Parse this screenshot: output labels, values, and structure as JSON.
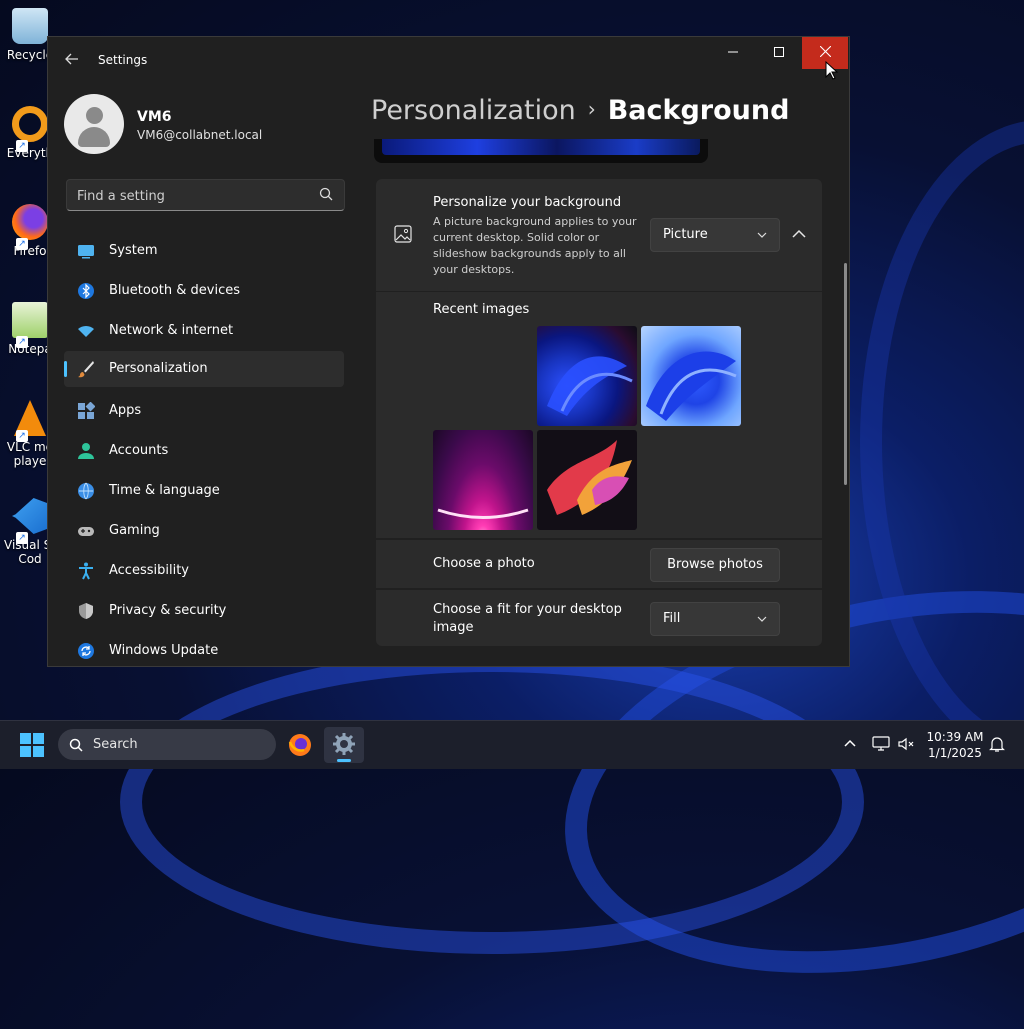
{
  "window": {
    "app_title": "Settings",
    "caption": {
      "minimize": "—",
      "maximize": "☐",
      "close": "✕"
    }
  },
  "user": {
    "name": "VM6",
    "email": "VM6@collabnet.local"
  },
  "search": {
    "placeholder": "Find a setting"
  },
  "nav": [
    {
      "label": "System",
      "icon": "system-icon"
    },
    {
      "label": "Bluetooth & devices",
      "icon": "bluetooth-icon"
    },
    {
      "label": "Network & internet",
      "icon": "wifi-icon"
    },
    {
      "label": "Personalization",
      "icon": "brush-icon",
      "active": true
    },
    {
      "label": "Apps",
      "icon": "apps-icon"
    },
    {
      "label": "Accounts",
      "icon": "accounts-icon"
    },
    {
      "label": "Time & language",
      "icon": "globe-clock-icon"
    },
    {
      "label": "Gaming",
      "icon": "gamepad-icon"
    },
    {
      "label": "Accessibility",
      "icon": "accessibility-icon"
    },
    {
      "label": "Privacy & security",
      "icon": "shield-icon"
    },
    {
      "label": "Windows Update",
      "icon": "update-icon"
    }
  ],
  "breadcrumb": {
    "parent": "Personalization",
    "separator": "›",
    "current": "Background"
  },
  "background": {
    "title": "Personalize your background",
    "description": "A picture background applies to your current desktop. Solid color or slideshow backgrounds apply to all your desktops.",
    "type_value": "Picture",
    "recent_label": "Recent images",
    "choose_photo_label": "Choose a photo",
    "browse_label": "Browse photos",
    "fit_label": "Choose a fit for your desktop image",
    "fit_value": "Fill"
  },
  "desktop_icons": [
    {
      "label": "Recycle",
      "icon": "recycle-bin-icon"
    },
    {
      "label": "Everyth",
      "icon": "everything-search-icon"
    },
    {
      "label": "Firefo",
      "icon": "firefox-icon"
    },
    {
      "label": "Notepa",
      "icon": "notepad-icon"
    },
    {
      "label": "VLC me\nplaye",
      "icon": "vlc-icon"
    },
    {
      "label": "Visual St\nCod",
      "icon": "vscode-icon"
    }
  ],
  "taskbar": {
    "search_text": "Search",
    "time": "10:39 AM",
    "date": "1/1/2025"
  },
  "colors": {
    "accent": "#4cc2ff",
    "close_hover": "#c42b1c",
    "window_bg": "#202020",
    "card_bg": "#2b2b2b"
  }
}
